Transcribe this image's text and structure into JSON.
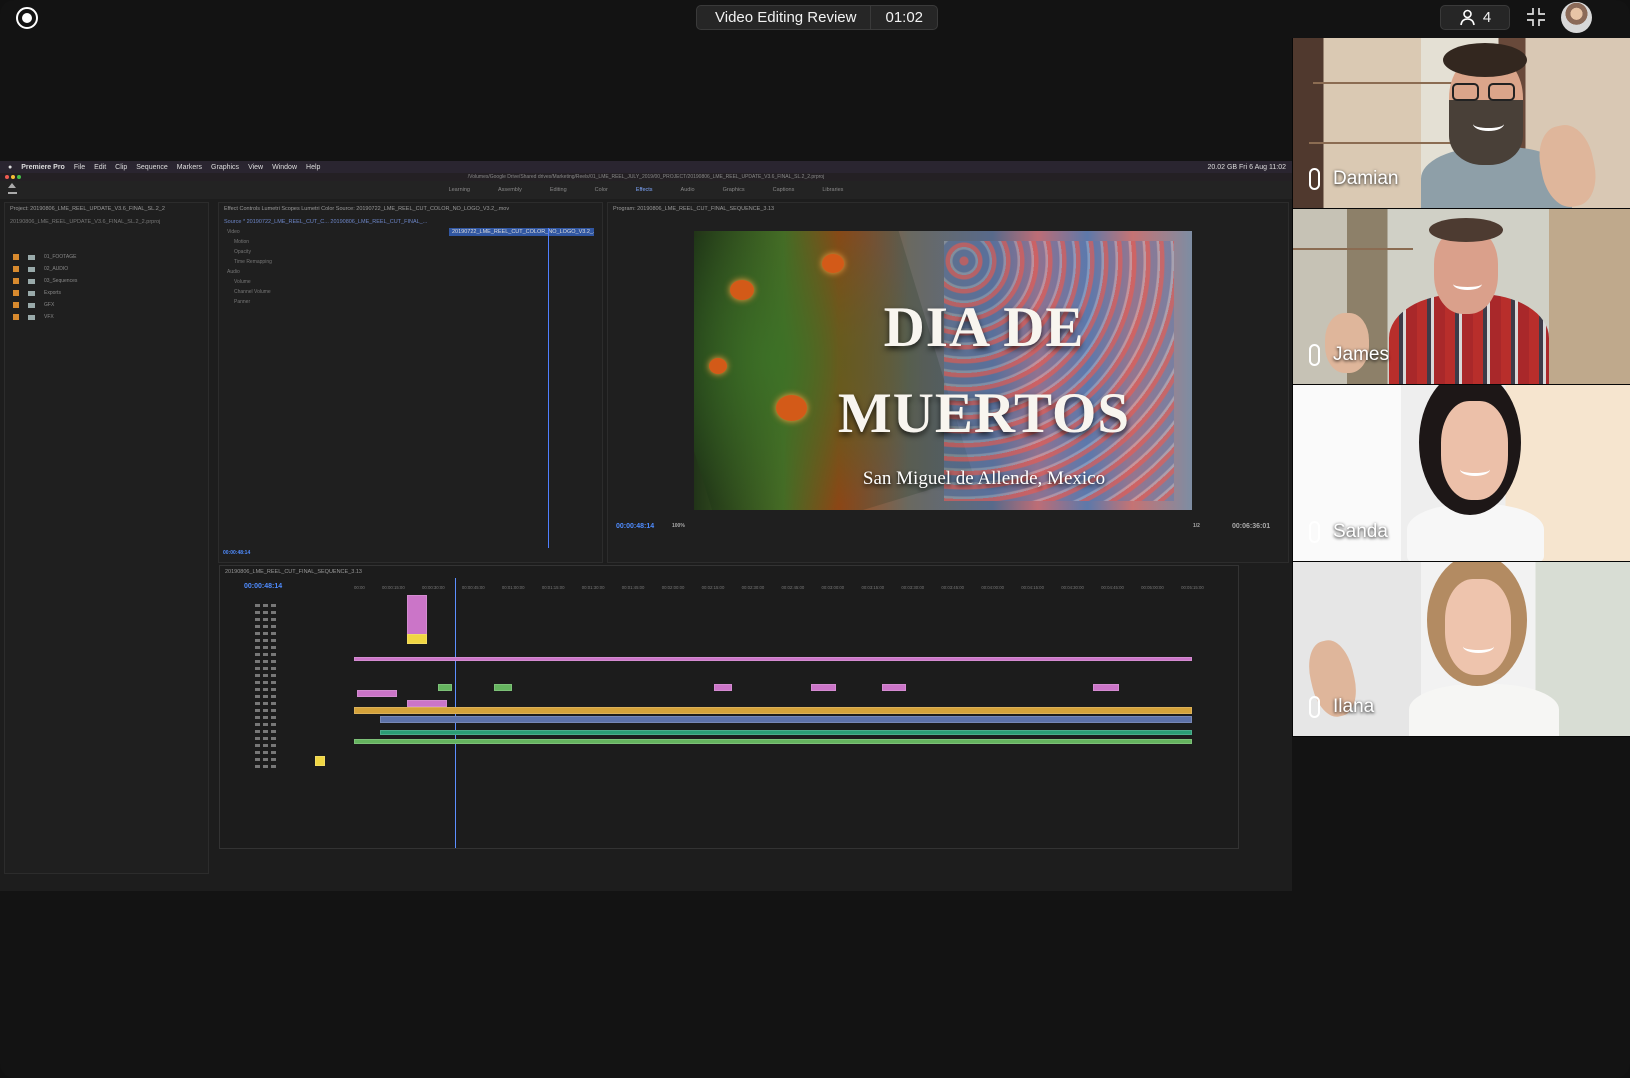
{
  "meeting": {
    "title": "Video Editing Review",
    "timer": "01:02",
    "participant_count": "4",
    "icons": [
      "record-icon",
      "person-icon",
      "minimize-icon"
    ]
  },
  "premiere": {
    "menu": [
      "Premiere Pro",
      "File",
      "Edit",
      "Clip",
      "Sequence",
      "Markers",
      "Graphics",
      "View",
      "Window",
      "Help"
    ],
    "status": "20.02 GB   Fri 6 Aug  11:02",
    "path": "/Volumes/Google Drive/Shared drives/Marketing/Reels/01_LME_REEL_JULY_2019/00_PROJECT/20190806_LME_REEL_UPDATE_V3.6_FINAL_SL.2_2.prproj",
    "workspaces": [
      "Learning",
      "Assembly",
      "Editing",
      "Color",
      "Effects",
      "Audio",
      "Graphics",
      "Captions",
      "Libraries"
    ],
    "project_title": "Project: 20190806_LME_REEL_UPDATE_V3.6_FINAL_SL.2_2",
    "project_file": "20190806_LME_REEL_UPDATE_V3.6_FINAL_SL.2_2.prproj",
    "project_items": [
      "01_FOOTAGE",
      "02_AUDIO",
      "03_Sequences",
      "Exports",
      "GFX",
      "VFX"
    ],
    "effect_tabs": "Effect Controls   Lumetri Scopes   Lumetri Color   Source: 20190722_LME_REEL_CUT_COLOR_NO_LOGO_V3.2_.mov",
    "effect_source": "Source * 20190722_LME_REEL_CUT_C...   20190806_LME_REEL_CUT_FINAL_...",
    "effect_clip": "20190722_LME_REEL_CUT_COLOR_NO_LOGO_V3.2_.mp",
    "effect_video_label": "Video",
    "effect_video": [
      "Motion",
      "Opacity",
      "Time Remapping"
    ],
    "effect_audio_label": "Audio",
    "effect_audio": [
      "Volume",
      "Channel Volume",
      "Panner"
    ],
    "effect_timecode": "00:00:48:14",
    "program_title": "Program: 20190806_LME_REEL_CUT_FINAL_SEQUENCE_3.13",
    "video_title_1": "DIA DE",
    "video_title_2": "MUERTOS",
    "video_subtitle": "San Miguel de Allende, Mexico",
    "program_time": "00:00:48:14",
    "program_zoom": "100%",
    "program_fraction": "1/2",
    "program_duration": "00:06:36:01",
    "timeline_title": "20190806_LME_REEL_CUT_FINAL_SEQUENCE_3.13",
    "timeline_time": "00:00:48:14",
    "ruler": [
      "00:00",
      "00:00:15:00",
      "00:00:30:00",
      "00:00:45:00",
      "00:01:00:00",
      "00:01:15:00",
      "00:01:30:00",
      "00:01:45:00",
      "00:02:00:00",
      "00:02:15:00",
      "00:02:30:00",
      "00:02:45:00",
      "00:03:00:00",
      "00:03:15:00",
      "00:03:30:00",
      "00:03:45:00",
      "00:04:00:00",
      "00:04:15:00",
      "00:04:30:00",
      "00:04:45:00",
      "00:05:00:00",
      "00:05:15:00"
    ]
  },
  "participants": [
    {
      "name": "Damian",
      "color": "#d9c8b4"
    },
    {
      "name": "James",
      "color": "#c7c1b5"
    },
    {
      "name": "Sanda",
      "color": "#f5f5f5"
    },
    {
      "name": "Ilana",
      "color": "#e8e8e8"
    }
  ]
}
